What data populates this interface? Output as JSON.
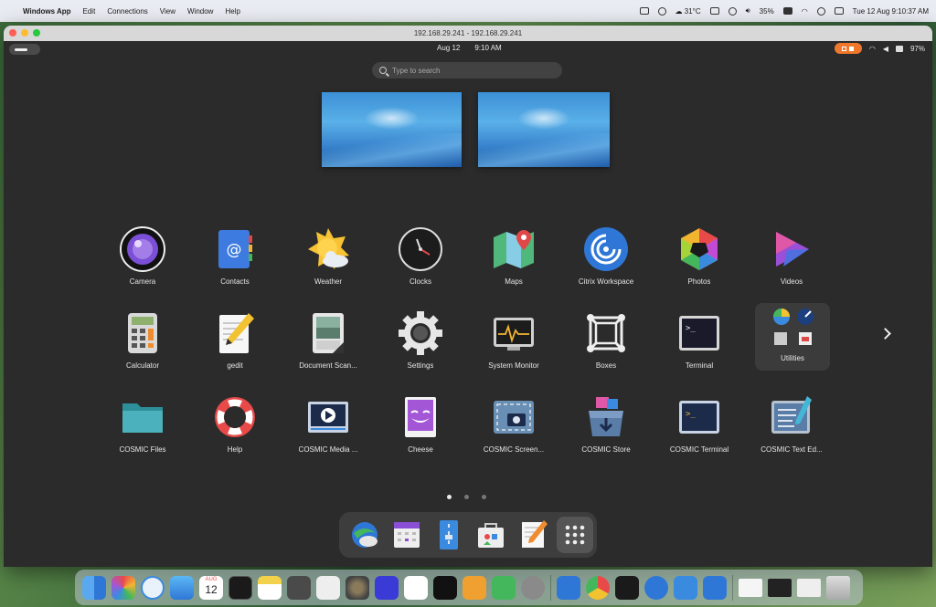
{
  "mac_menubar": {
    "app_name": "Windows App",
    "menus": [
      "Edit",
      "Connections",
      "View",
      "Window",
      "Help"
    ],
    "weather": "31°C",
    "battery": "35%",
    "datetime": "Tue 12 Aug  9:10:37 AM"
  },
  "window": {
    "title": "192.168.29.241 - 192.168.29.241"
  },
  "cosmic_topbar": {
    "date": "Aug 12",
    "time": "9:10 AM",
    "battery": "97%"
  },
  "search": {
    "placeholder": "Type to search"
  },
  "apps_row1": [
    {
      "label": "Camera",
      "icon": "camera-icon"
    },
    {
      "label": "Contacts",
      "icon": "contacts-icon"
    },
    {
      "label": "Weather",
      "icon": "weather-icon"
    },
    {
      "label": "Clocks",
      "icon": "clocks-icon"
    },
    {
      "label": "Maps",
      "icon": "maps-icon"
    },
    {
      "label": "Citrix Workspace",
      "icon": "citrix-icon"
    },
    {
      "label": "Photos",
      "icon": "photos-icon"
    },
    {
      "label": "Videos",
      "icon": "videos-icon"
    }
  ],
  "apps_row2": [
    {
      "label": "Calculator",
      "icon": "calculator-icon"
    },
    {
      "label": "gedit",
      "icon": "gedit-icon"
    },
    {
      "label": "Document Scan...",
      "icon": "document-scanner-icon"
    },
    {
      "label": "Settings",
      "icon": "settings-icon"
    },
    {
      "label": "System Monitor",
      "icon": "system-monitor-icon"
    },
    {
      "label": "Boxes",
      "icon": "boxes-icon"
    },
    {
      "label": "Terminal",
      "icon": "terminal-icon"
    },
    {
      "label": "Utilities",
      "icon": "utilities-folder-icon"
    }
  ],
  "apps_row3": [
    {
      "label": "COSMIC Files",
      "icon": "files-icon"
    },
    {
      "label": "Help",
      "icon": "help-icon"
    },
    {
      "label": "COSMIC Media ...",
      "icon": "media-player-icon"
    },
    {
      "label": "Cheese",
      "icon": "cheese-icon"
    },
    {
      "label": "COSMIC Screen...",
      "icon": "screenshot-icon"
    },
    {
      "label": "COSMIC Store",
      "icon": "store-icon"
    },
    {
      "label": "COSMIC Terminal",
      "icon": "cosmic-terminal-icon"
    },
    {
      "label": "COSMIC Text Ed...",
      "icon": "text-editor-icon"
    }
  ],
  "calendar_day": "12",
  "calendar_month": "AUG",
  "colors": {
    "panel_bg": "#2b2b2b",
    "accent_orange": "#f0782d",
    "label_text": "#e6e6e6"
  }
}
